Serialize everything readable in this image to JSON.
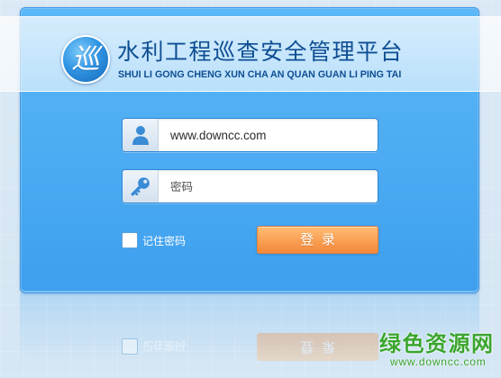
{
  "theme": {
    "background": "#d5e6f4",
    "panel_top": "#5cb8f6",
    "panel_bottom": "#3d9fee",
    "title_color": "#0e4e93",
    "button_top": "#ffbc72",
    "button_bottom": "#f4873a",
    "icon_color": "#3a8bd6",
    "watermark_color": "#3aa52e"
  },
  "header": {
    "logo": {
      "icon": "patrol-logo-icon",
      "glyph": "巡"
    },
    "title": "水利工程巡查安全管理平台",
    "subtitle": "SHUI LI GONG CHENG XUN CHA AN QUAN GUAN LI PING TAI"
  },
  "login": {
    "username": {
      "icon": "user-icon",
      "value": "www.downcc.com"
    },
    "password": {
      "icon": "key-icon",
      "placeholder": "密码"
    },
    "remember": {
      "label": "记住密码",
      "checked": false
    },
    "submit_label": "登 录"
  },
  "watermark": {
    "name": "绿色资源网",
    "url": "www.downcc.com"
  }
}
